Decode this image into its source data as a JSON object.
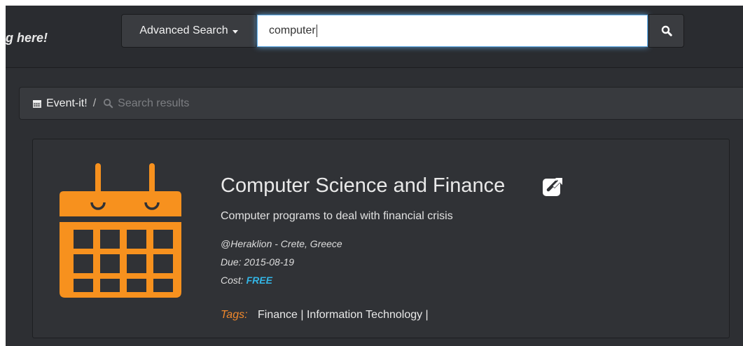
{
  "header": {
    "tagline": "g here!",
    "advanced_search_label": "Advanced Search",
    "search_value": "computer",
    "icons": {
      "dropdown": "caret-down-icon",
      "search": "search-icon"
    }
  },
  "breadcrumb": {
    "home_label": "Event-it!",
    "separator": "/",
    "current_label": "Search results",
    "icons": {
      "home": "calendar-icon",
      "current": "search-icon"
    }
  },
  "result": {
    "title": "Computer Science and Finance",
    "description": "Computer programs to deal with financial crisis",
    "location": "@Heraklion - Crete, Greece",
    "due_label": "Due:",
    "due_date": "2015-08-19",
    "cost_label": "Cost:",
    "cost_value": "FREE",
    "tags_label": "Tags:",
    "tags": "Finance | Information Technology |",
    "icons": {
      "event": "calendar-icon",
      "open": "external-link-icon"
    }
  },
  "colors": {
    "background": "#2d2f33",
    "accent_orange": "#f7911e",
    "cost_blue": "#33b5e5",
    "input_focus": "#66afe9"
  }
}
